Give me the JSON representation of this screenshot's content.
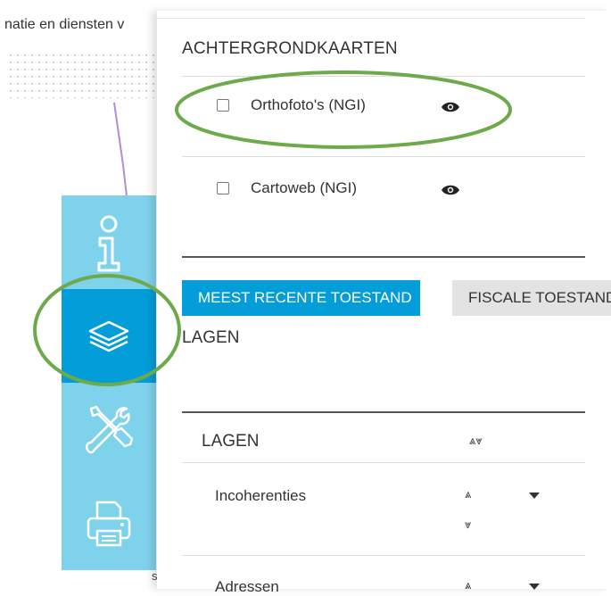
{
  "map": {
    "header_text": "natie en diensten v",
    "bottom_glyph": "s"
  },
  "toolbar": {
    "items": [
      {
        "icon": "info-icon",
        "active": false
      },
      {
        "icon": "layers-icon",
        "active": true
      },
      {
        "icon": "tools-icon",
        "active": false
      },
      {
        "icon": "printer-icon",
        "active": false
      }
    ],
    "bg_color": "#7fd2ec",
    "active_color": "#039dd9"
  },
  "panel": {
    "background_maps": {
      "title": "ACHTERGRONDKAARTEN",
      "items": [
        {
          "label": "Orthofoto's (NGI)",
          "checked": false
        },
        {
          "label": "Cartoweb (NGI)",
          "checked": false
        }
      ]
    },
    "tabs": [
      {
        "label": "MEEST RECENTE TOESTAND",
        "active": true
      },
      {
        "label": "FISCALE TOESTAND",
        "active": false
      }
    ],
    "layers_title": "LAGEN",
    "layers_table": {
      "header": "LAGEN",
      "sort_up_down": "≈",
      "rows": [
        {
          "name": "Incoherenties"
        },
        {
          "name": "Adressen"
        }
      ]
    }
  },
  "annotation": {
    "color": "#6ea94a"
  }
}
